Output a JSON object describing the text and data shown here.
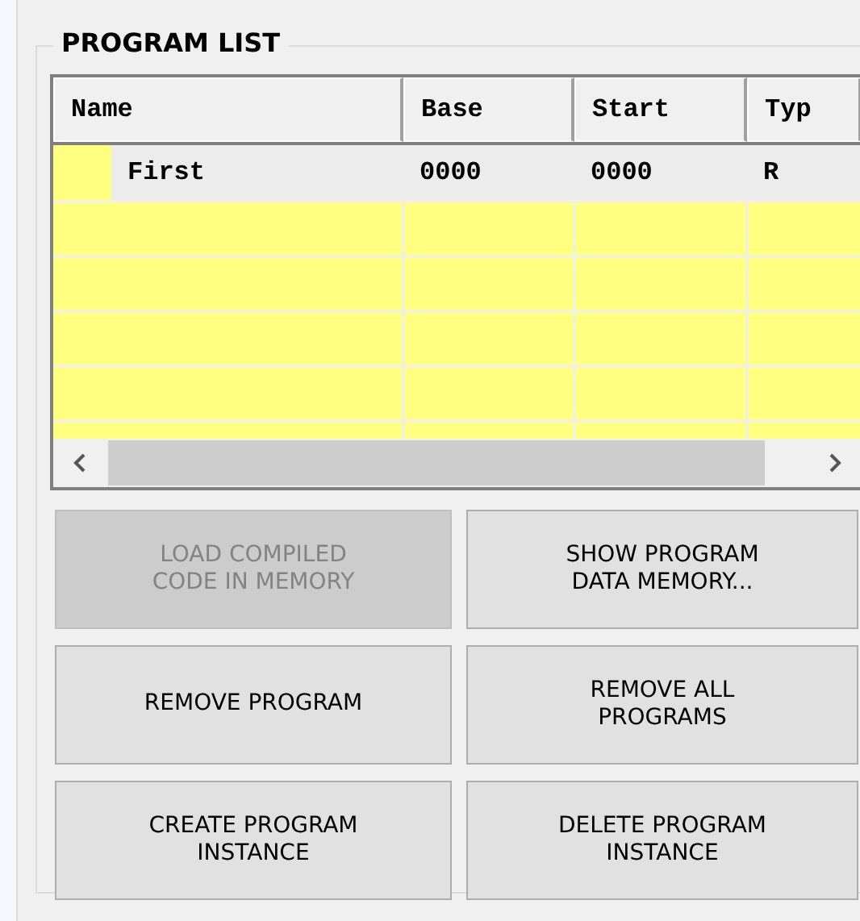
{
  "group": {
    "title": "PROGRAM LIST"
  },
  "table": {
    "columns": [
      "Name",
      "Base",
      "Start",
      "Typ"
    ],
    "rows": [
      {
        "cells": [
          "First",
          "0000",
          "0000",
          "R"
        ],
        "selected": true
      }
    ]
  },
  "buttons": [
    {
      "label": "LOAD COMPILED\nCODE IN MEMORY",
      "disabled": true
    },
    {
      "label": "SHOW PROGRAM\nDATA MEMORY...",
      "disabled": false
    },
    {
      "label": "REMOVE PROGRAM",
      "disabled": false
    },
    {
      "label": "REMOVE ALL\nPROGRAMS",
      "disabled": false
    },
    {
      "label": "CREATE PROGRAM\nINSTANCE",
      "disabled": false
    },
    {
      "label": "DELETE PROGRAM\nINSTANCE",
      "disabled": false
    }
  ]
}
